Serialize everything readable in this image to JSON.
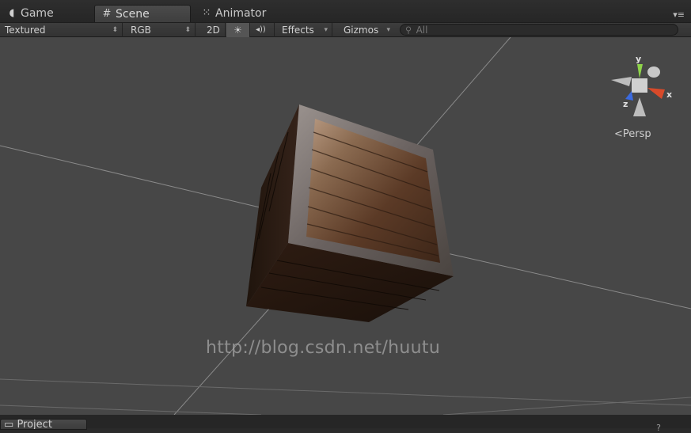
{
  "tabs": [
    {
      "label": "Game",
      "icon": "pacman-icon"
    },
    {
      "label": "Scene",
      "icon": "grid-icon"
    },
    {
      "label": "Animator",
      "icon": "animator-icon"
    }
  ],
  "tab_menu": "▾≡",
  "toolbar": {
    "render_mode": "Textured",
    "color_mode": "RGB",
    "mode_2d": "2D",
    "lighting_icon": "☀",
    "audio_icon": "◂))",
    "effects": "Effects",
    "gizmos": "Gizmos",
    "search_placeholder": "All"
  },
  "scene": {
    "gizmo_axes": {
      "y": "y",
      "x": "x",
      "z": "z"
    },
    "persp_label": "Persp",
    "watermark": "http://blog.csdn.net/huutu"
  },
  "bottom": {
    "tab_label": "Project",
    "right_text": "?"
  },
  "colors": {
    "viewport_bg": "#474747",
    "axis_y": "#8fd44a",
    "axis_x": "#d84a2a",
    "axis_z": "#3a6ae0"
  }
}
